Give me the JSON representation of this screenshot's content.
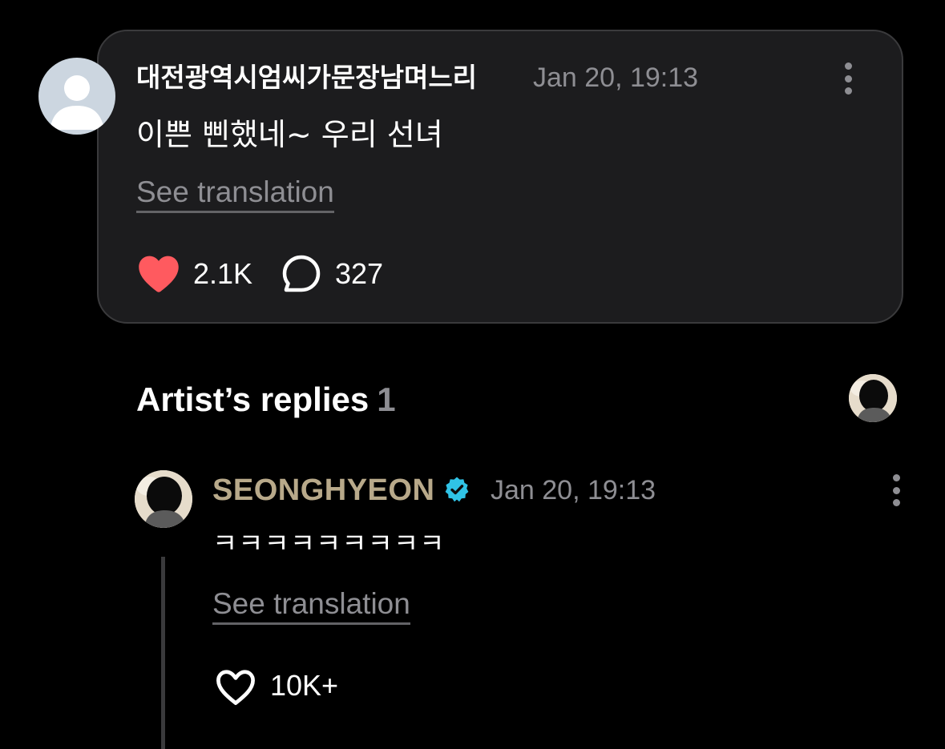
{
  "comment": {
    "username": "대전광역시엄씨가문장남며느리",
    "timestamp": "Jan 20, 19:13",
    "text": "이쁜 삔했네~ 우리 선녀",
    "see_translation": "See translation",
    "likes": "2.1K",
    "replies": "327",
    "liked": true,
    "like_color": "#ff5a5f"
  },
  "artist_replies": {
    "title": "Artist’s replies",
    "count": "1",
    "reply": {
      "artist_name": "SEONGHYEON",
      "verified": true,
      "verified_color": "#30c3e6",
      "name_color": "#b8a98a",
      "timestamp": "Jan 20, 19:13",
      "text": "ㅋㅋㅋㅋㅋㅋㅋㅋㅋ",
      "see_translation": "See translation",
      "likes": "10K+",
      "liked": false
    }
  },
  "icons": {
    "default_avatar": "user-placeholder-icon",
    "more": "more-vertical-icon",
    "like_filled": "heart-filled-icon",
    "comment": "comment-bubble-icon",
    "verified": "verified-badge-icon",
    "like_outline": "heart-outline-icon"
  }
}
